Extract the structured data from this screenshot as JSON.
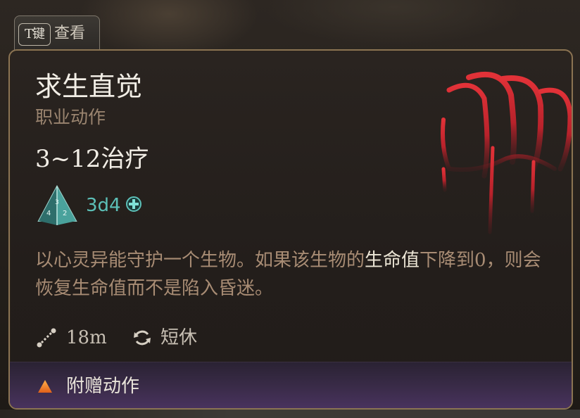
{
  "hint": {
    "key": "T键",
    "label": "查看"
  },
  "spell": {
    "title": "求生直觉",
    "subtitle": "职业动作",
    "effect": "3~12治疗",
    "dice": "3d4",
    "description": {
      "part1": "以心灵异能守护一个生物。如果该生物的",
      "highlight": "生命值",
      "part2": "下降到0，则会恢复生命值而不是陷入昏迷。"
    },
    "range": "18m",
    "recharge": "短休",
    "cost": "附赠动作"
  },
  "colors": {
    "title": "#f2eee6",
    "subtitle": "#9b8570",
    "dice": "#5cbfb7",
    "description": "#a88c74",
    "highlight": "#ece6d6",
    "claw": "#c0202a",
    "border": "#8b7453",
    "footer": "#4a3360",
    "action_triangle": "#f07a1c"
  },
  "icons": {
    "spell": "claw-marks-icon",
    "dice": "d4-die-icon",
    "heal": "heal-plus-icon",
    "range": "range-icon",
    "recharge": "recharge-icon",
    "cost": "bonus-action-triangle-icon"
  }
}
